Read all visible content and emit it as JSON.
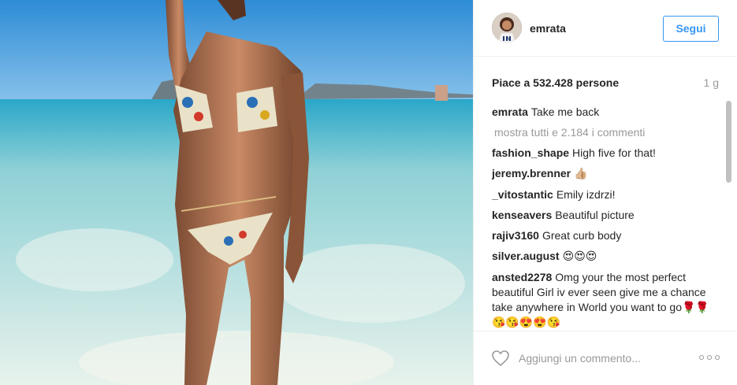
{
  "photo": {
    "description_icon": "photo-icon"
  },
  "header": {
    "username": "emrata",
    "follow_label": "Segui",
    "avatar_icon": "avatar-icon"
  },
  "likes": {
    "text": "Piace a 532.428 persone",
    "age": "1 g"
  },
  "comments": {
    "caption": {
      "user": "emrata",
      "text": "Take me back"
    },
    "show_all": "mostra tutti e 2.184 i commenti",
    "items": [
      {
        "user": "fashion_shape",
        "text": "High five for that!"
      },
      {
        "user": "jeremy.brenner",
        "text": "👍🏼"
      },
      {
        "user": "_vitostantic",
        "text": "Emily izdrzi!"
      },
      {
        "user": "kenseavers",
        "text": "Beautiful picture"
      },
      {
        "user": "rajiv3160",
        "text": "Great curb body"
      },
      {
        "user": "silver.august",
        "text": "😍😍😍"
      },
      {
        "user": "ansted2278",
        "text": "Omg your the most perfect beautiful Girl iv ever seen give me a chance take anywhere in World you want to go🌹🌹😘😘😍😍😘"
      }
    ]
  },
  "comment_bar": {
    "placeholder": "Aggiungi un commento...",
    "heart_icon": "heart-icon",
    "more_icon": "more-options-icon"
  },
  "colors": {
    "link_blue": "#3897f0",
    "muted": "#999999",
    "text": "#262626",
    "border": "#efefef"
  }
}
